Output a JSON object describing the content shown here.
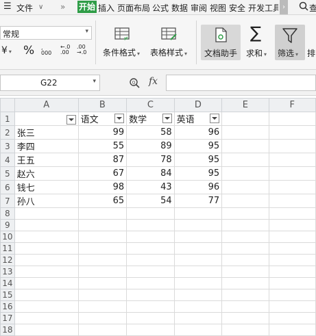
{
  "menubar": {
    "file": "文件",
    "more": "»",
    "tabs": [
      "开始",
      "插入",
      "页面布局",
      "公式",
      "数据",
      "审阅",
      "视图",
      "安全",
      "开发工具"
    ],
    "search_glyph": "查"
  },
  "ribbon": {
    "font_value": "常规",
    "percent": "%",
    "thousands": "000",
    "dec_inc": "+.0 .00",
    "dec_dec": "+.0 .0",
    "conditional_format": "条件格式",
    "table_style": "表格样式",
    "doc_assistant": "文档助手",
    "sum": "求和",
    "filter": "筛选",
    "sort": "排"
  },
  "formula_bar": {
    "name_box": "G22",
    "fx": "fx"
  },
  "sheet": {
    "columns": [
      "A",
      "B",
      "C",
      "D",
      "E",
      "F"
    ],
    "header_row": [
      "",
      "语文",
      "数学",
      "英语",
      "",
      ""
    ],
    "rows": [
      {
        "name": "张三",
        "chinese": "99",
        "math": "58",
        "english": "96"
      },
      {
        "name": "李四",
        "chinese": "55",
        "math": "89",
        "english": "95"
      },
      {
        "name": "王五",
        "chinese": "87",
        "math": "78",
        "english": "95"
      },
      {
        "name": "赵六",
        "chinese": "67",
        "math": "84",
        "english": "95"
      },
      {
        "name": "钱七",
        "chinese": "98",
        "math": "43",
        "english": "96"
      },
      {
        "name": "孙八",
        "chinese": "65",
        "math": "54",
        "english": "77"
      }
    ],
    "row_numbers": [
      "1",
      "2",
      "3",
      "4",
      "5",
      "6",
      "7",
      "8",
      "9",
      "10",
      "11",
      "12",
      "13",
      "14",
      "15",
      "16",
      "17",
      "18"
    ]
  }
}
